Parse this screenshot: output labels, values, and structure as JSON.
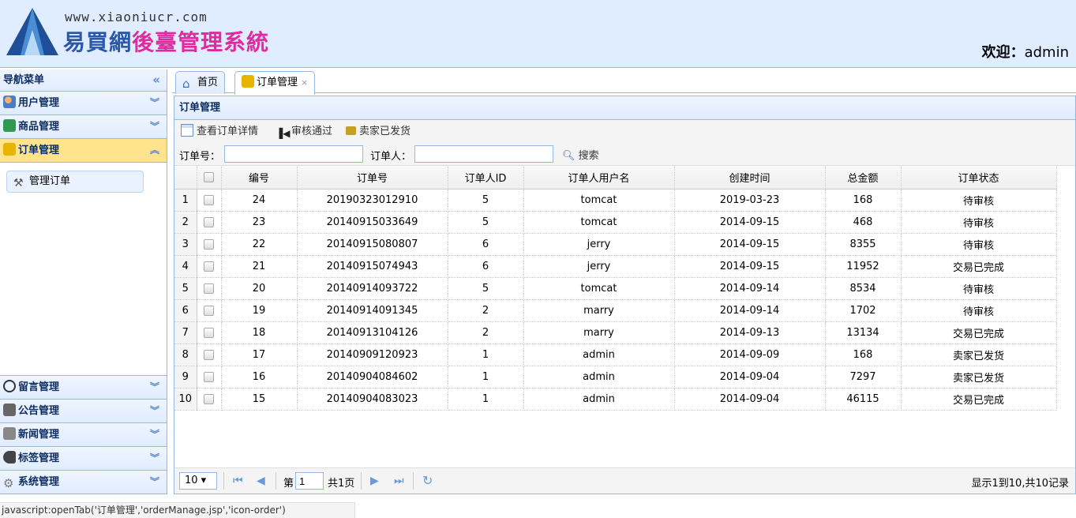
{
  "header": {
    "site_url": "www.xiaoniucr.com",
    "title_part1": "易買網",
    "title_part2": "後臺管理系統",
    "welcome_label": "欢迎：",
    "username": "admin"
  },
  "nav": {
    "title": "导航菜单",
    "sections": [
      {
        "label": "用户管理",
        "icon": "users-icon"
      },
      {
        "label": "商品管理",
        "icon": "goods-icon"
      },
      {
        "label": "订单管理",
        "icon": "order-icon",
        "selected": true
      },
      {
        "label": "留言管理",
        "icon": "message-icon"
      },
      {
        "label": "公告管理",
        "icon": "notice-icon"
      },
      {
        "label": "新闻管理",
        "icon": "news-icon"
      },
      {
        "label": "标签管理",
        "icon": "tag-icon"
      },
      {
        "label": "系统管理",
        "icon": "gear-icon"
      }
    ],
    "sub_items": [
      {
        "label": "管理订单",
        "icon": "tools-icon"
      }
    ]
  },
  "tabs": [
    {
      "label": "首页",
      "icon": "home-icon"
    },
    {
      "label": "订单管理",
      "icon": "order-icon",
      "selected": true,
      "close": "×"
    }
  ],
  "panel": {
    "title": "订单管理",
    "toolbar": {
      "view_detail": "查看订单详情",
      "approve": "审核通过",
      "shipped": "卖家已发货"
    },
    "search": {
      "order_no_label": "订单号：",
      "orderer_label": "订单人：",
      "order_no_value": "",
      "orderer_value": "",
      "search_button": "搜索"
    }
  },
  "grid": {
    "columns": [
      "编号",
      "订单号",
      "订单人ID",
      "订单人用户名",
      "创建时间",
      "总金额",
      "订单状态"
    ],
    "rows": [
      [
        "1",
        "24",
        "20190323012910",
        "5",
        "tomcat",
        "2019-03-23",
        "168",
        "待审核"
      ],
      [
        "2",
        "23",
        "20140915033649",
        "5",
        "tomcat",
        "2014-09-15",
        "468",
        "待审核"
      ],
      [
        "3",
        "22",
        "20140915080807",
        "6",
        "jerry",
        "2014-09-15",
        "8355",
        "待审核"
      ],
      [
        "4",
        "21",
        "20140915074943",
        "6",
        "jerry",
        "2014-09-15",
        "11952",
        "交易已完成"
      ],
      [
        "5",
        "20",
        "20140914093722",
        "5",
        "tomcat",
        "2014-09-14",
        "8534",
        "待审核"
      ],
      [
        "6",
        "19",
        "20140914091345",
        "2",
        "marry",
        "2014-09-14",
        "1702",
        "待审核"
      ],
      [
        "7",
        "18",
        "20140913104126",
        "2",
        "marry",
        "2014-09-13",
        "13134",
        "交易已完成"
      ],
      [
        "8",
        "17",
        "20140909120923",
        "1",
        "admin",
        "2014-09-09",
        "168",
        "卖家已发货"
      ],
      [
        "9",
        "16",
        "20140904084602",
        "1",
        "admin",
        "2014-09-04",
        "7297",
        "卖家已发货"
      ],
      [
        "10",
        "15",
        "20140904083023",
        "1",
        "admin",
        "2014-09-04",
        "46115",
        "交易已完成"
      ]
    ]
  },
  "pager": {
    "page_size": "10 ▾",
    "page_prefix": "第",
    "page_value": "1",
    "page_suffix": "共1页",
    "info": "显示1到10,共10记录"
  },
  "statusbar": "javascript:openTab('订单管理','orderManage.jsp','icon-order')",
  "colors": {
    "accent_border": "#95b8e7",
    "header_bg": "#e0ecff",
    "selected_nav": "#ffe48d"
  }
}
